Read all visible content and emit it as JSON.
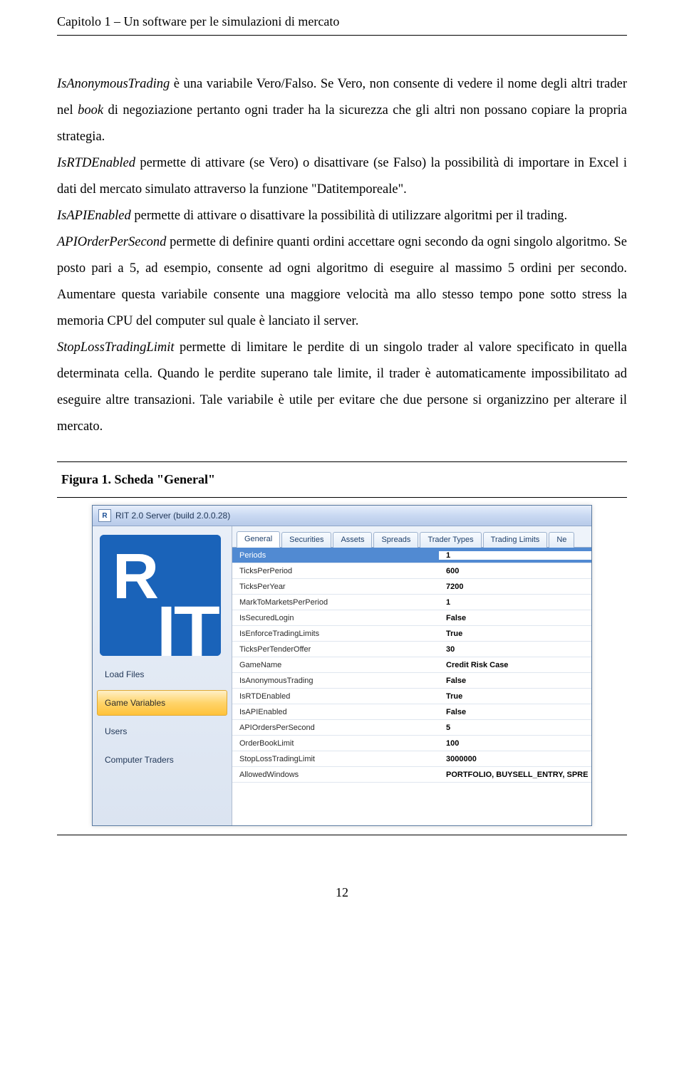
{
  "header": {
    "chapter": "Capitolo 1 – Un software per le simulazioni di mercato"
  },
  "paragraphs": {
    "p1_a": "IsAnonymousTrading",
    "p1_b": " è una variabile Vero/Falso. Se Vero, non consente di vedere il nome degli altri trader nel ",
    "p1_c": "book",
    "p1_d": " di negoziazione pertanto ogni trader ha la sicurezza che gli altri non possano copiare la propria strategia.",
    "p2_a": "IsRTDEnabled",
    "p2_b": " permette di attivare (se Vero) o disattivare (se Falso) la possibilità di importare in Excel i dati del mercato simulato attraverso la funzione \"Datitemporeale\".",
    "p3_a": "IsAPIEnabled",
    "p3_b": " permette di attivare o disattivare la possibilità di utilizzare algoritmi per il trading.",
    "p4_a": "APIOrderPerSecond",
    "p4_b": " permette di definire quanti ordini accettare ogni secondo da ogni singolo algoritmo. Se posto pari a 5, ad esempio, consente ad ogni algoritmo di eseguire al massimo 5 ordini per secondo. Aumentare questa variabile consente una maggiore velocità ma allo stesso tempo pone sotto stress la memoria CPU del computer sul quale è lanciato il server.",
    "p5_a": "StopLossTradingLimit",
    "p5_b": " permette di limitare le perdite di un singolo trader al valore specificato in quella determinata cella. Quando le perdite superano tale limite, il trader è automaticamente impossibilitato ad eseguire altre transazioni. Tale variabile è utile per evitare che due persone si organizzino per alterare il mercato."
  },
  "figure": {
    "label": "Figura 1.",
    "title": " Scheda \"General\""
  },
  "app": {
    "title": "RIT 2.0 Server (build 2.0.0.28)",
    "sidebar": {
      "load_files": "Load Files",
      "game_variables": "Game Variables",
      "users": "Users",
      "computer_traders": "Computer Traders"
    },
    "tabs": {
      "general": "General",
      "securities": "Securities",
      "assets": "Assets",
      "spreads": "Spreads",
      "trader_types": "Trader Types",
      "trading_limits": "Trading Limits",
      "ne": "Ne"
    },
    "props": {
      "Periods": "1",
      "TicksPerPeriod": "600",
      "TicksPerYear": "7200",
      "MarkToMarketsPerPeriod": "1",
      "IsSecuredLogin": "False",
      "IsEnforceTradingLimits": "True",
      "TicksPerTenderOffer": "30",
      "GameName": "Credit Risk Case",
      "IsAnonymousTrading": "False",
      "IsRTDEnabled": "True",
      "IsAPIEnabled": "False",
      "APIOrdersPerSecond": "5",
      "OrderBookLimit": "100",
      "StopLossTradingLimit": "3000000",
      "AllowedWindows": "PORTFOLIO, BUYSELL_ENTRY, SPRE"
    },
    "prop_labels": {
      "Periods": "Periods",
      "TicksPerPeriod": "TicksPerPeriod",
      "TicksPerYear": "TicksPerYear",
      "MarkToMarketsPerPeriod": "MarkToMarketsPerPeriod",
      "IsSecuredLogin": "IsSecuredLogin",
      "IsEnforceTradingLimits": "IsEnforceTradingLimits",
      "TicksPerTenderOffer": "TicksPerTenderOffer",
      "GameName": "GameName",
      "IsAnonymousTrading": "IsAnonymousTrading",
      "IsRTDEnabled": "IsRTDEnabled",
      "IsAPIEnabled": "IsAPIEnabled",
      "APIOrdersPerSecond": "APIOrdersPerSecond",
      "OrderBookLimit": "OrderBookLimit",
      "StopLossTradingLimit": "StopLossTradingLimit",
      "AllowedWindows": "AllowedWindows"
    }
  },
  "page_number": "12"
}
